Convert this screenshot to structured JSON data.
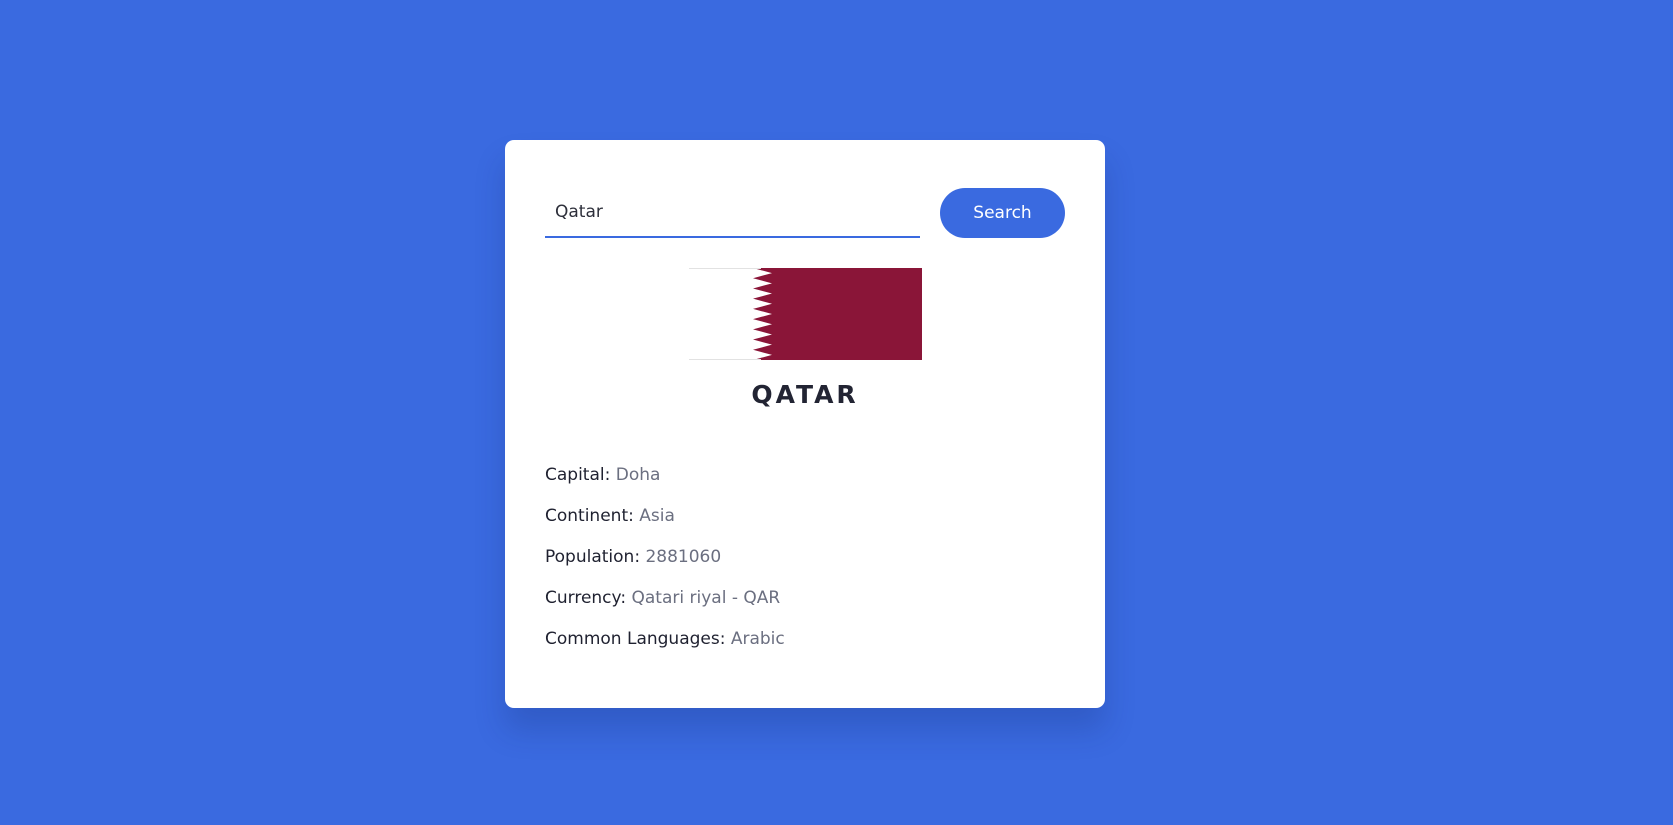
{
  "search": {
    "value": "Qatar",
    "button_label": "Search"
  },
  "country": {
    "name": "QATAR",
    "flag_icon": "qatar-flag",
    "flag_colors": {
      "white": "#ffffff",
      "maroon": "#8a1538"
    }
  },
  "details": [
    {
      "label": "Capital:",
      "value": "Doha"
    },
    {
      "label": "Continent:",
      "value": "Asia"
    },
    {
      "label": "Population:",
      "value": "2881060"
    },
    {
      "label": "Currency:",
      "value": "Qatari riyal - QAR"
    },
    {
      "label": "Common Languages:",
      "value": "Arabic"
    }
  ],
  "colors": {
    "background": "#3a6ae0",
    "accent": "#3a6ae0",
    "card": "#ffffff"
  }
}
